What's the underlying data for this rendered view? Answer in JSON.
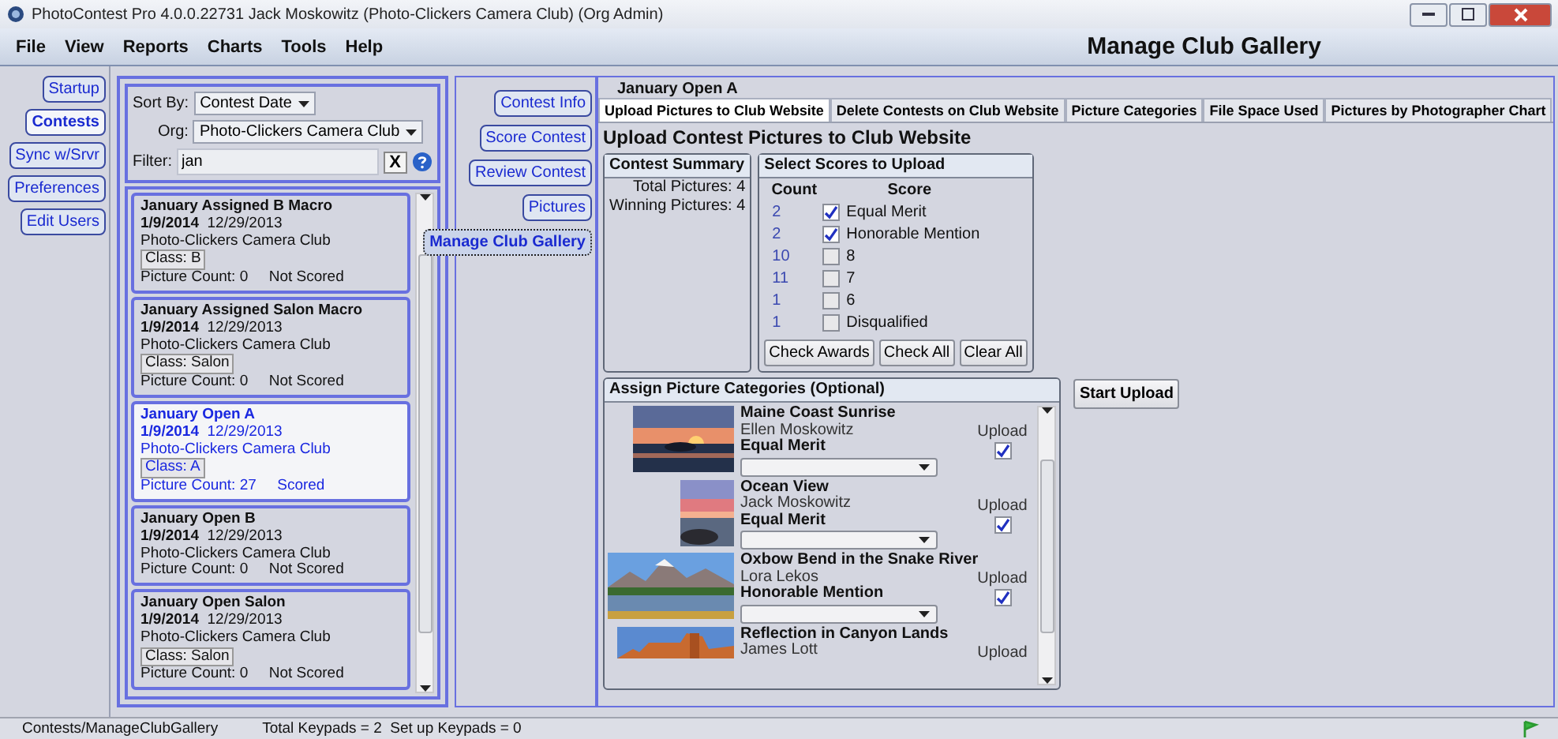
{
  "window": {
    "title": "PhotoContest Pro 4.0.0.22731 Jack Moskowitz (Photo-Clickers Camera Club) (Org Admin)"
  },
  "menu": [
    "File",
    "View",
    "Reports",
    "Charts",
    "Tools",
    "Help"
  ],
  "page_title": "Manage Club Gallery",
  "nav": [
    {
      "label": "Startup",
      "selected": false
    },
    {
      "label": "Contests",
      "selected": true
    },
    {
      "label": "Sync w/Srvr",
      "selected": false
    },
    {
      "label": "Preferences",
      "selected": false
    },
    {
      "label": "Edit Users",
      "selected": false
    }
  ],
  "contest_filter": {
    "sort_label": "Sort By:",
    "sort_value": "Contest Date",
    "org_label": "Org:",
    "org_value": "Photo-Clickers Camera Club",
    "filter_label": "Filter:",
    "filter_value": "jan",
    "clear": "X"
  },
  "contests": [
    {
      "title": "January Assigned B Macro",
      "date": "1/9/2014",
      "date2": "12/29/2013",
      "org": "Photo-Clickers Camera Club",
      "class": "Class: B",
      "count": "Picture Count: 0",
      "status": "Not Scored",
      "selected": false
    },
    {
      "title": "January Assigned Salon Macro",
      "date": "1/9/2014",
      "date2": "12/29/2013",
      "org": "Photo-Clickers Camera Club",
      "class": "Class: Salon",
      "count": "Picture Count: 0",
      "status": "Not Scored",
      "selected": false
    },
    {
      "title": "January Open A",
      "date": "1/9/2014",
      "date2": "12/29/2013",
      "org": "Photo-Clickers Camera Club",
      "class": "Class: A",
      "count": "Picture Count: 27",
      "status": "Scored",
      "selected": true
    },
    {
      "title": "January Open B",
      "date": "1/9/2014",
      "date2": "12/29/2013",
      "org": "Photo-Clickers Camera Club",
      "count": "Picture Count: 0",
      "status": "Not Scored",
      "selected": false
    },
    {
      "title": "January Open Salon",
      "date": "1/9/2014",
      "date2": "12/29/2013",
      "org": "Photo-Clickers Camera Club",
      "class": "Class: Salon",
      "count": "Picture Count: 0",
      "status": "Not Scored",
      "selected": false
    }
  ],
  "sub_nav": [
    {
      "label": "Contest Info",
      "selected": false
    },
    {
      "label": "Score Contest",
      "selected": false
    },
    {
      "label": "Review Contest",
      "selected": false
    },
    {
      "label": "Pictures",
      "selected": false
    },
    {
      "label": "Manage Club Gallery",
      "selected": true
    }
  ],
  "contest_name": "January Open A",
  "tabs": [
    {
      "label": "Upload Pictures to Club Website",
      "selected": true
    },
    {
      "label": "Delete Contests on Club Website",
      "selected": false
    },
    {
      "label": "Picture Categories",
      "selected": false
    },
    {
      "label": "File Space Used",
      "selected": false
    },
    {
      "label": "Pictures by Photographer Chart",
      "selected": false
    }
  ],
  "heading": "Upload Contest Pictures to Club Website",
  "summary": {
    "title": "Contest Summary",
    "lines": [
      "Total Pictures: 4",
      "Winning Pictures: 4"
    ]
  },
  "scores": {
    "title": "Select Scores to Upload",
    "columns": [
      "Count",
      "Score"
    ],
    "rows": [
      {
        "count": "2",
        "label": "Equal Merit",
        "checked": true
      },
      {
        "count": "2",
        "label": "Honorable Mention",
        "checked": true
      },
      {
        "count": "10",
        "label": "8",
        "checked": false
      },
      {
        "count": "11",
        "label": "7",
        "checked": false
      },
      {
        "count": "1",
        "label": "6",
        "checked": false
      },
      {
        "count": "1",
        "label": "Disqualified",
        "checked": false
      }
    ],
    "buttons": [
      "Check Awards",
      "Check All",
      "Clear All"
    ]
  },
  "categories": {
    "title": "Assign Picture Categories (Optional)",
    "items": [
      {
        "title": "Maine Coast Sunrise",
        "author": "Ellen Moskowitz",
        "upload_label": "Upload",
        "upload": true,
        "score": "Equal Merit"
      },
      {
        "title": "Ocean View",
        "author": "Jack Moskowitz",
        "upload_label": "Upload",
        "upload": true,
        "score": "Equal Merit"
      },
      {
        "title": "Oxbow Bend in the Snake River",
        "author": "Lora Lekos",
        "upload_label": "Upload",
        "upload": true,
        "score": "Honorable Mention"
      },
      {
        "title": "Reflection in Canyon Lands",
        "author": "James Lott",
        "upload_label": "Upload"
      }
    ]
  },
  "start_upload": "Start Upload",
  "status_bar": [
    "Contests/ManageClubGallery",
    "Total Keypads = 2  Set up Keypads = 0"
  ]
}
